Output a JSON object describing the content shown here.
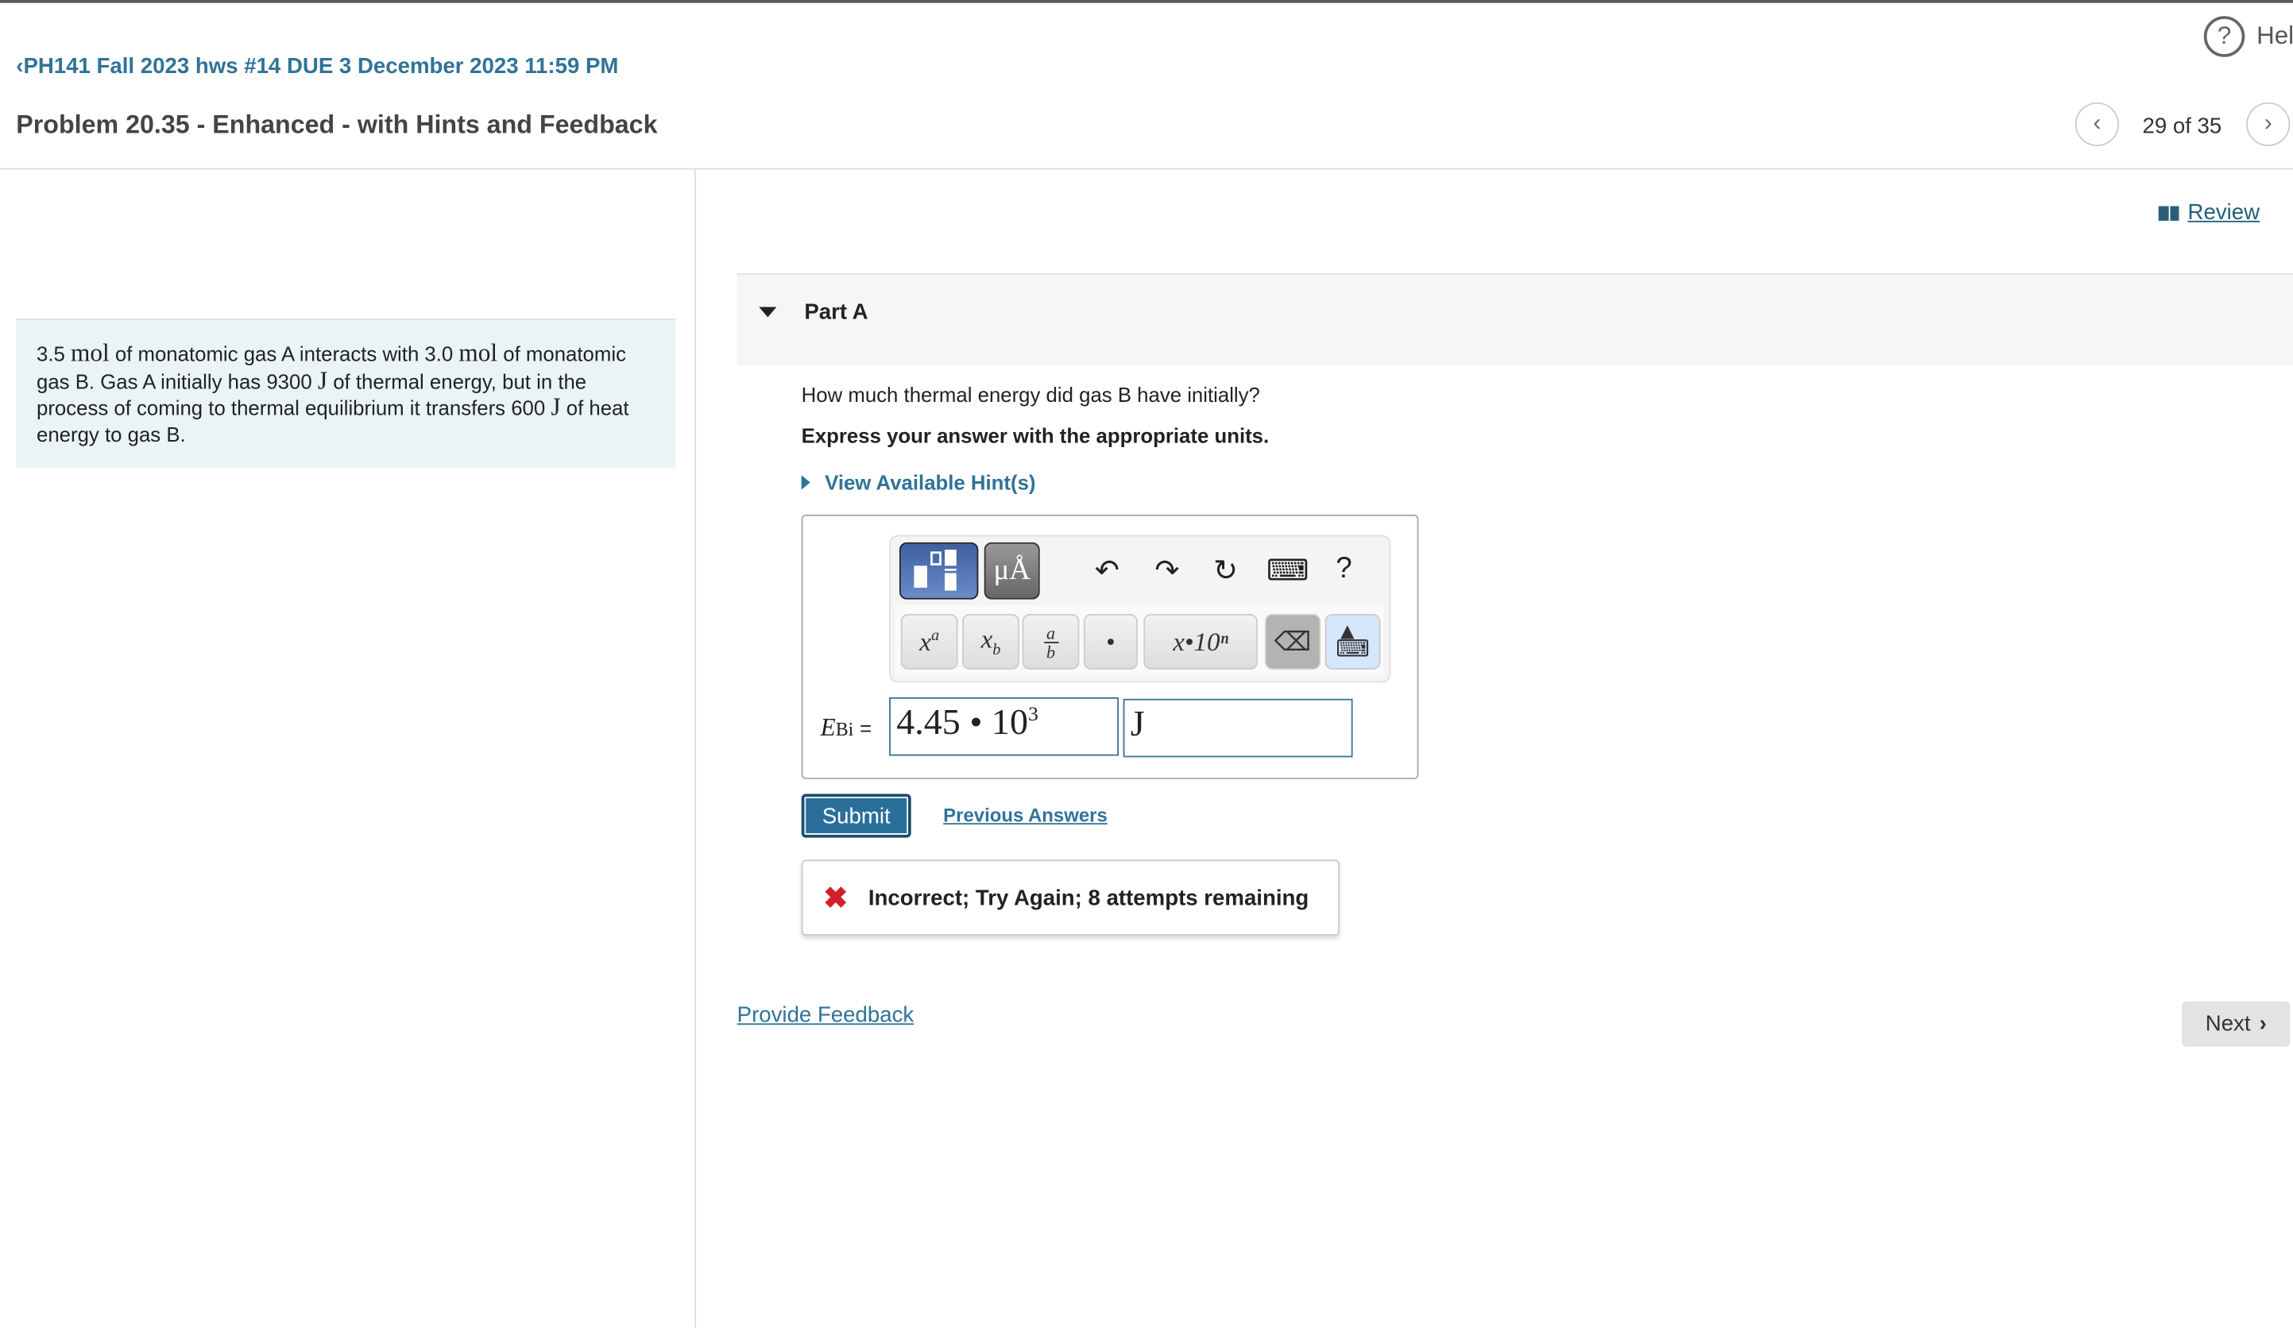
{
  "header": {
    "help_label": "Help",
    "back_link": "PH141 Fall 2023 hws #14 DUE 3 December 2023 11:59 PM",
    "title": "Problem 20.35 - Enhanced - with Hints and Feedback",
    "counter": "29 of 35"
  },
  "problem": {
    "segments": [
      "3.5 ",
      "mol",
      " of monatomic gas A interacts with 3.0 ",
      "mol",
      " of monatomic gas B. Gas A initially has 9300 ",
      "J",
      " of thermal energy, but in the process of coming to thermal equilibrium it transfers 600 ",
      "J",
      " of heat energy to gas B."
    ]
  },
  "review_label": "Review",
  "part": {
    "title": "Part A",
    "question": "How much thermal energy did gas B have initially?",
    "instruction": "Express your answer with the appropriate units.",
    "hint_label": "View Available Hint(s)"
  },
  "toolbar": {
    "units_label": "μÅ",
    "help_label": "?",
    "dot_label": "•",
    "sci_label": "x•10ⁿ"
  },
  "answer": {
    "variable": "E",
    "subscript": "Bi",
    "equals": "=",
    "value_mantissa": "4.45 • 10",
    "value_exponent": "3",
    "unit": "J"
  },
  "submit_label": "Submit",
  "previous_answers_label": "Previous Answers",
  "feedback": {
    "status": "incorrect",
    "message": "Incorrect; Try Again; 8 attempts remaining",
    "color": "#d0202a"
  },
  "provide_feedback_label": "Provide Feedback",
  "next_label": "Next"
}
